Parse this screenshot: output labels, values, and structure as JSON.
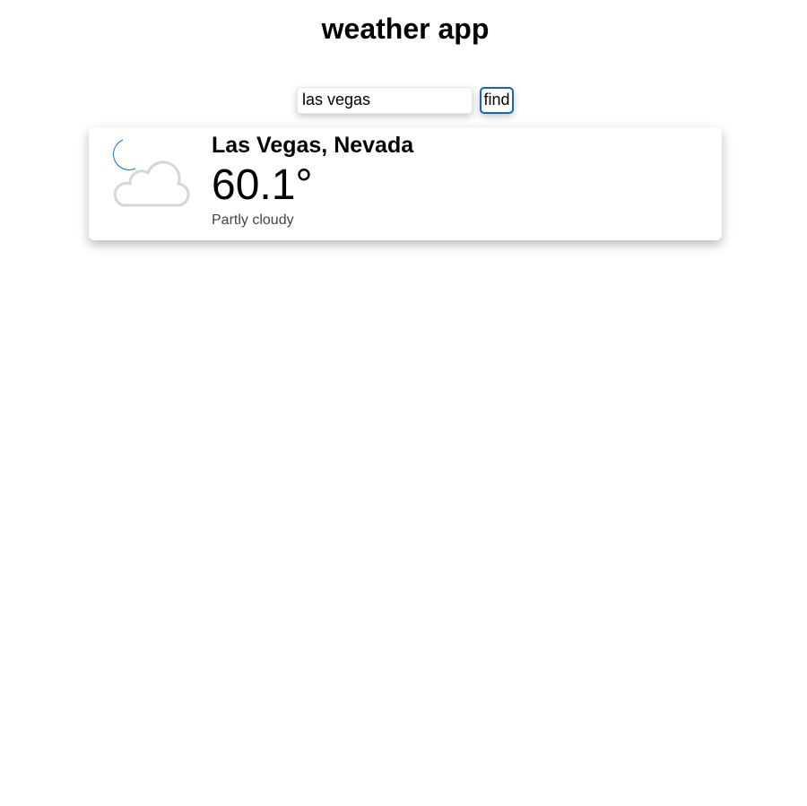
{
  "app": {
    "title": "weather app"
  },
  "search": {
    "value": "las vegas",
    "button_label": "find"
  },
  "weather_card": {
    "location": "Las Vegas, Nevada",
    "temperature": "60.1°",
    "condition": "Partly cloudy",
    "icon": "moon-cloud-icon"
  },
  "colors": {
    "accent": "#1565c0",
    "moon": "#1a73d9",
    "cloud_outline": "#d6d6d6",
    "condition_text": "#444444"
  }
}
